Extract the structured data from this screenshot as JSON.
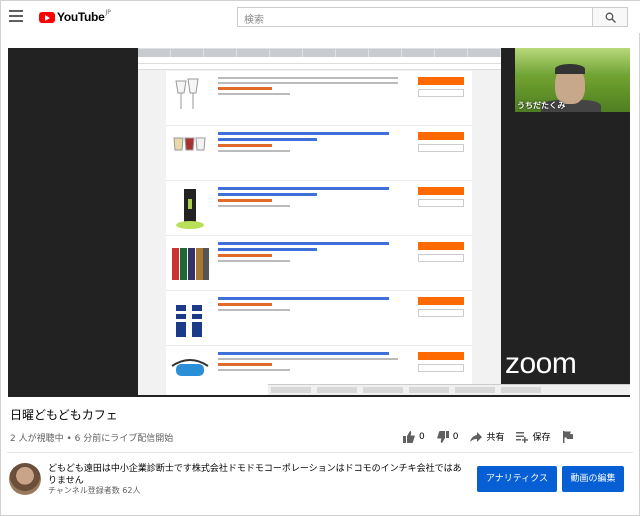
{
  "header": {
    "logo_text": "YouTube",
    "logo_region": "JP",
    "search_placeholder": "検索"
  },
  "video": {
    "webcam_name": "うちだたくみ",
    "zoom_watermark": "zoom"
  },
  "info": {
    "title": "日曜どもどもカフェ",
    "meta": "2 人が視聴中 • 6 分前にライブ配信開始",
    "likes": "0",
    "dislikes": "0",
    "share_label": "共有",
    "save_label": "保存"
  },
  "channel": {
    "name": "どもども遠田は中小企業診断士です株式会社ドモドモコーポレーションはドコモのインチキ会社ではありません",
    "subscribers": "チャンネル登録者数 62人",
    "analytics_label": "アナリティクス",
    "edit_label": "動画の編集"
  },
  "colors": {
    "brand_red": "#ff0000",
    "button_blue": "#065fd4"
  }
}
